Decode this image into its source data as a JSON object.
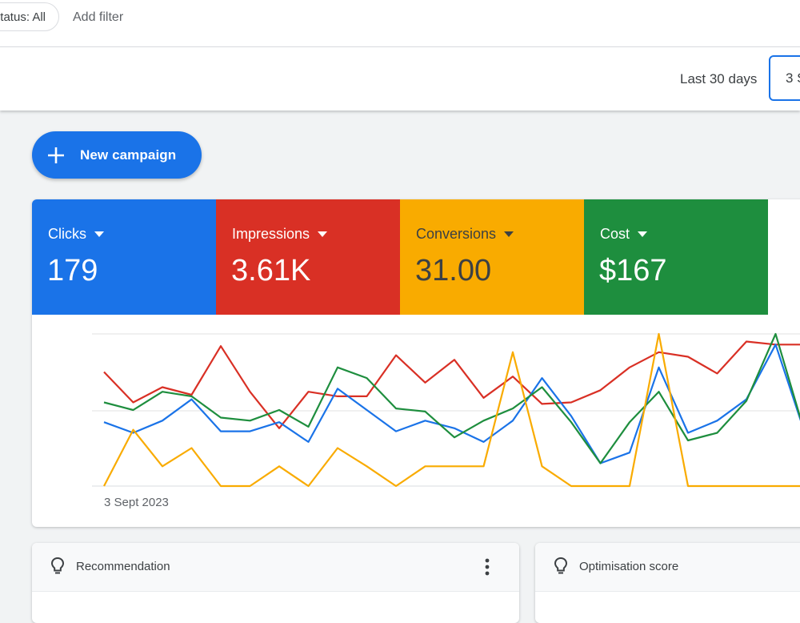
{
  "filters": {
    "status_chip": "Status: All",
    "add_filter": "Add filter"
  },
  "date_range": {
    "label": "Last 30 days",
    "value": "3 S"
  },
  "new_campaign": {
    "label": "New campaign",
    "icon": "plus-icon"
  },
  "metrics": [
    {
      "label": "Clicks",
      "value": "179",
      "color": "#1a73e8"
    },
    {
      "label": "Impressions",
      "value": "3.61K",
      "color": "#d93025"
    },
    {
      "label": "Conversions",
      "value": "31.00",
      "color": "#f9ab00"
    },
    {
      "label": "Cost",
      "value": "$167",
      "color": "#1e8e3e"
    }
  ],
  "chart_data": {
    "type": "line",
    "x_start_label": "3 Sept 2023",
    "series": [
      {
        "name": "Impressions",
        "color": "#d93025",
        "values": [
          0.75,
          0.55,
          0.65,
          0.6,
          0.92,
          0.62,
          0.38,
          0.62,
          0.59,
          0.59,
          0.86,
          0.68,
          0.83,
          0.58,
          0.72,
          0.54,
          0.55,
          0.63,
          0.78,
          0.88,
          0.85,
          0.74,
          0.95,
          0.93,
          0.93
        ]
      },
      {
        "name": "Clicks",
        "color": "#1a73e8",
        "values": [
          0.42,
          0.35,
          0.43,
          0.57,
          0.36,
          0.36,
          0.42,
          0.29,
          0.64,
          0.5,
          0.36,
          0.43,
          0.38,
          0.29,
          0.43,
          0.71,
          0.46,
          0.15,
          0.22,
          0.78,
          0.35,
          0.43,
          0.57,
          0.93,
          0.35
        ]
      },
      {
        "name": "Conversions",
        "color": "#1e8e3e",
        "values": [
          0.55,
          0.5,
          0.62,
          0.59,
          0.45,
          0.43,
          0.5,
          0.39,
          0.78,
          0.71,
          0.51,
          0.49,
          0.32,
          0.43,
          0.51,
          0.65,
          0.42,
          0.15,
          0.42,
          0.62,
          0.3,
          0.35,
          0.56,
          1.0,
          0.35
        ]
      },
      {
        "name": "Cost",
        "color": "#f9ab00",
        "values": [
          0.0,
          0.37,
          0.13,
          0.25,
          0.0,
          0.0,
          0.13,
          0.0,
          0.25,
          0.13,
          0.0,
          0.13,
          0.13,
          0.13,
          0.88,
          0.13,
          0.0,
          0.0,
          0.0,
          1.0,
          0.0,
          0.0,
          0.0,
          0.0,
          0.0
        ]
      }
    ]
  },
  "cards": {
    "recommendation": {
      "title": "Recommendation",
      "icon": "lightbulb-icon",
      "menu_icon": "more-vert-icon"
    },
    "optimisation": {
      "title": "Optimisation score",
      "icon": "lightbulb-icon"
    }
  }
}
